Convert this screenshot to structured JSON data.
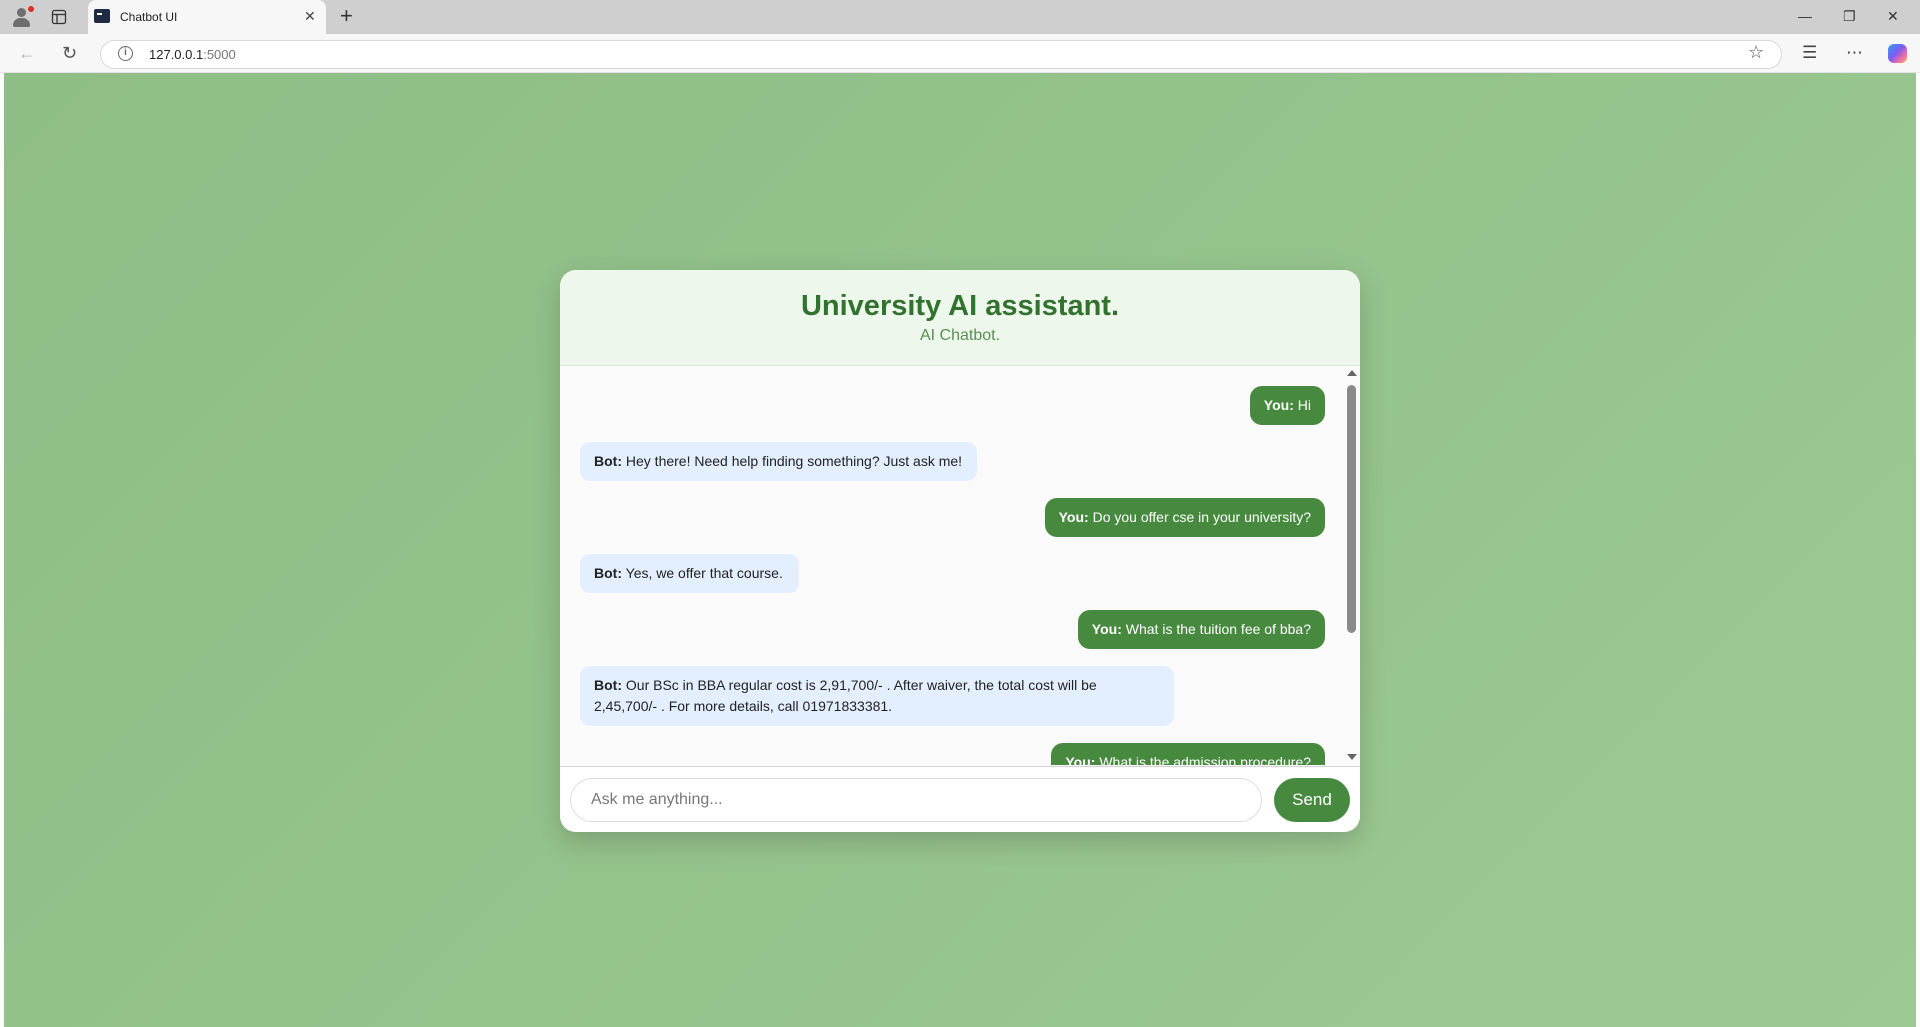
{
  "browser": {
    "tab_title": "Chatbot UI",
    "tab_close_icon": "close-icon",
    "new_tab_icon": "plus-icon",
    "url_host": "127.0.0.1",
    "url_port": ":5000",
    "window_buttons": [
      "minimize-icon",
      "restore-icon",
      "close-icon"
    ],
    "toolbar_icons": [
      "back-icon",
      "reload-icon",
      "star-icon",
      "favorites-icon",
      "more-icon",
      "copilot-icon"
    ]
  },
  "chat": {
    "title": "University AI assistant.",
    "subtitle": "AI Chatbot.",
    "messages": [
      {
        "sender": "You:",
        "text": " Hi",
        "role": "user"
      },
      {
        "sender": "Bot:",
        "text": " Hey there! Need help finding something? Just ask me!",
        "role": "bot"
      },
      {
        "sender": "You:",
        "text": " Do you offer cse in your university?",
        "role": "user"
      },
      {
        "sender": "Bot:",
        "text": " Yes, we offer that course.",
        "role": "bot"
      },
      {
        "sender": "You:",
        "text": " What is the tuition fee of bba?",
        "role": "user"
      },
      {
        "sender": "Bot:",
        "text": " Our BSc in BBA regular cost is 2,91,700/- . After waiver, the total cost will be 2,45,700/- . For more details, call 01971833381.",
        "role": "bot"
      },
      {
        "sender": "You:",
        "text": " What is the admission procedure?",
        "role": "user"
      }
    ],
    "input_placeholder": "Ask me anything...",
    "input_value": "",
    "send_label": "Send"
  },
  "colors": {
    "page_background": "#95c38c",
    "accent": "#478a3f",
    "title": "#33722e",
    "bot_bubble": "#e3efff"
  }
}
